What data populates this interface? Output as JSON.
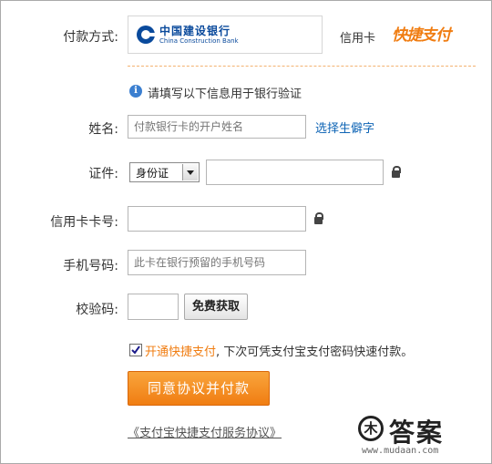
{
  "payment": {
    "label": "付款方式:",
    "bank_cn": "中国建设银行",
    "bank_en": "China Construction Bank",
    "card_type": "信用卡",
    "quickpay_logo": "快捷支付"
  },
  "notice": {
    "text": "请填写以下信息用于银行验证",
    "icon": "info-icon"
  },
  "form": {
    "name_label": "姓名:",
    "name_placeholder": "付款银行卡的开户姓名",
    "rare_char_link": "选择生僻字",
    "id_label": "证件:",
    "id_type_selected": "身份证",
    "id_number_value": "",
    "card_label": "信用卡卡号:",
    "card_value": "",
    "phone_label": "手机号码:",
    "phone_placeholder": "此卡在银行预留的手机号码",
    "code_label": "校验码:",
    "code_value": "",
    "get_code_button": "免费获取"
  },
  "agreement": {
    "checked": true,
    "enable_text": "开通快捷支付",
    "rest_text": ", 下次可凭支付宝支付密码快速付款。",
    "submit_button": "同意协议并付款",
    "link_text": "《支付宝快捷支付服务协议》"
  },
  "watermark": {
    "cn": "答案",
    "url": "www.mudaan.com"
  },
  "colors": {
    "accent_orange": "#f07d12",
    "link_blue": "#0e64b5",
    "bank_blue": "#0a4a9c"
  }
}
